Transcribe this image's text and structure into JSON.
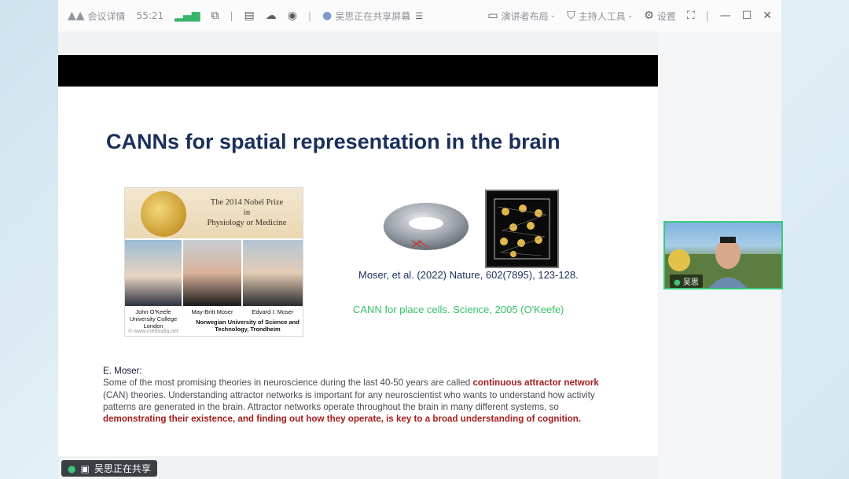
{
  "topbar": {
    "meeting_details": "会议详情",
    "timer": "55:21",
    "sharing_status": "吴思正在共享屏幕",
    "presenter_layout": "演讲者布局",
    "host_tools": "主持人工具",
    "settings": "设置"
  },
  "slide": {
    "title": "CANNs for spatial representation in the brain",
    "nobel_title": "The 2014 Nobel Prize\nin\nPhysiology or Medicine",
    "laureates": [
      {
        "name": "John O'Keefe",
        "affil": "University College London"
      },
      {
        "name": "May-Britt Moser",
        "affil": ""
      },
      {
        "name": "Edvard I. Moser",
        "affil": ""
      }
    ],
    "shared_affil": "Norwegian University of Science and Technology, Trondheim",
    "watermark": "© www.medindia.net",
    "ref1": "Moser, et al. (2022) Nature, 602(7895), 123-128.",
    "ref2": "CANN for place cells. Science, 2005 (O'Keefe)",
    "quote_author": "E. Moser",
    "quote_p1": "Some of the most promising theories in neuroscience during the last 40-50 years are called ",
    "quote_r1": "continuous attractor network",
    "quote_p2": " (CAN) theories. Understanding attractor networks is important for any neuroscientist who wants to understand how activity patterns are generated in the brain. Attractor networks operate throughout the brain in many different systems, so ",
    "quote_r2": "demonstrating their existence, and finding out how they operate, is key to a broad understanding of cognition."
  },
  "camera": {
    "name": "吴思"
  },
  "share_badge": "吴思正在共享"
}
